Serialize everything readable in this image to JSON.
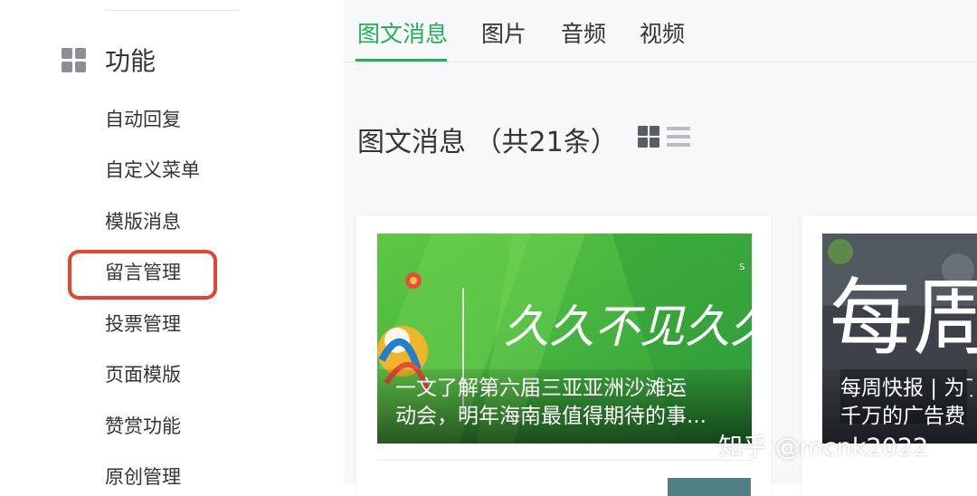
{
  "sidebar": {
    "section_title": "功能",
    "section_icon": "grid-icon",
    "items": [
      {
        "label": "自动回复"
      },
      {
        "label": "自定义菜单"
      },
      {
        "label": "模版消息"
      },
      {
        "label": "留言管理",
        "highlighted": true
      },
      {
        "label": "投票管理"
      },
      {
        "label": "页面模版"
      },
      {
        "label": "赞赏功能"
      },
      {
        "label": "原创管理"
      }
    ]
  },
  "tabs": [
    {
      "label": "图文消息",
      "active": true
    },
    {
      "label": "图片"
    },
    {
      "label": "音频"
    },
    {
      "label": "视频"
    }
  ],
  "content": {
    "title": "图文消息 （共21条）",
    "view_icons": [
      "grid-view-icon",
      "list-view-icon"
    ]
  },
  "cards": [
    {
      "caption_line1": "一文了解第六届三亚亚洲沙滩运",
      "caption_line2": "动会，明年海南最值得期待的事...",
      "cover_text": "久久不见久久见"
    },
    {
      "caption_line1": "每周快报 | 为了",
      "caption_line2": "千万的广告费",
      "cover_text": "每周"
    }
  ],
  "watermark": "知乎 @mcnk2022",
  "colors": {
    "accent": "#22b056",
    "highlight_border": "#e8432f",
    "background_main": "#f6f8f9"
  }
}
